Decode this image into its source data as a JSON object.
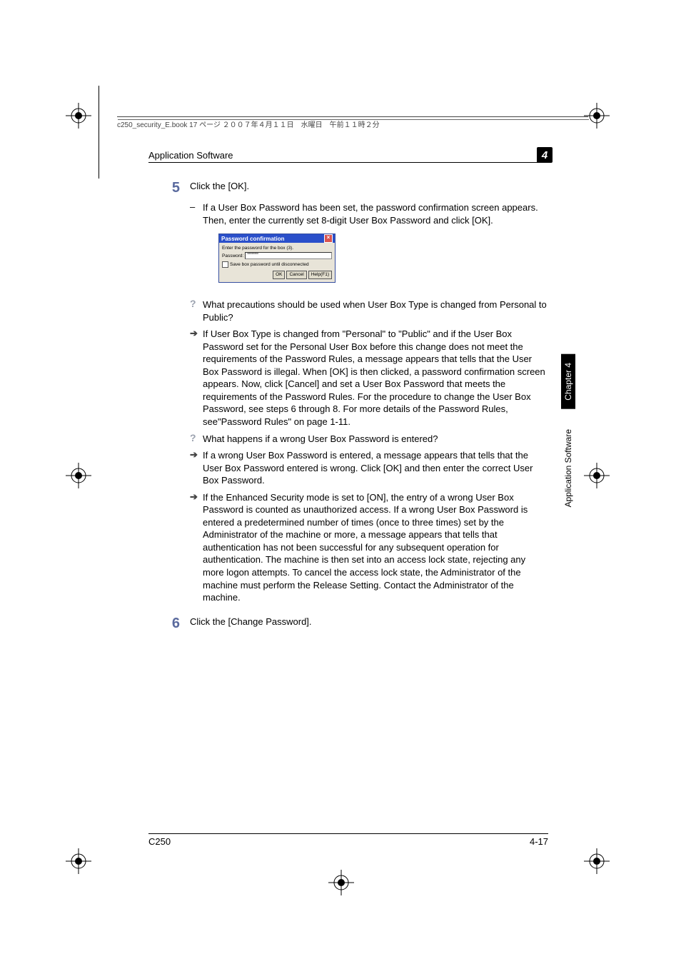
{
  "header_meta": "c250_security_E.book  17 ページ  ２００７年４月１１日　水曜日　午前１１時２分",
  "section": {
    "title": "Application Software",
    "chapter_badge": "4"
  },
  "steps": {
    "s5": {
      "num": "5",
      "text": "Click the [OK].",
      "sub": "If a User Box Password has been set, the password confirmation screen appears. Then, enter the currently set 8-digit User Box Password and click [OK]."
    },
    "s6": {
      "num": "6",
      "text": "Click the [Change Password]."
    }
  },
  "dialog": {
    "title": "Password confirmation",
    "prompt": "Enter the password for the box (3).",
    "password_label": "Password:",
    "password_value": "********",
    "checkbox_label": "Save box password until disconnected",
    "ok": "OK",
    "cancel": "Cancel",
    "help": "Help(F1)"
  },
  "qa": {
    "q1": "What precautions should be used when User Box Type is changed from Personal to Public?",
    "a1": "If User Box Type is changed from \"Personal\" to \"Public\" and if the User Box Password set for the Personal User Box before this change does not meet the requirements of the Password Rules, a message appears that tells that the User Box Password is illegal. When [OK] is then clicked, a password confirmation screen appears. Now, click [Cancel] and set a User Box Password that meets the requirements of the Password Rules. For the procedure to change the User Box Password, see steps 6 through 8. For more details of the Password Rules, see\"Password Rules\" on page 1-11.",
    "q2": "What happens if a wrong User Box Password is entered?",
    "a2": "If a wrong User Box Password is entered, a message appears that tells that the User Box Password entered is wrong. Click [OK] and then enter the correct User Box Password.",
    "a3": "If the Enhanced Security mode is set to [ON], the entry of a wrong User Box Password is counted as unauthorized access. If a wrong User Box Password is entered a predetermined number of times (once to three times) set by the Administrator of the machine or more, a message appears that tells that authentication has not been successful for any subsequent operation for authentication. The machine is then set into an access lock state, rejecting any more logon attempts. To cancel the access lock state, the Administrator of the machine must perform the Release Setting. Contact the Administrator of the machine."
  },
  "sidetabs": {
    "chapter": "Chapter 4",
    "section": "Application Software"
  },
  "footer": {
    "model": "C250",
    "page": "4-17"
  }
}
